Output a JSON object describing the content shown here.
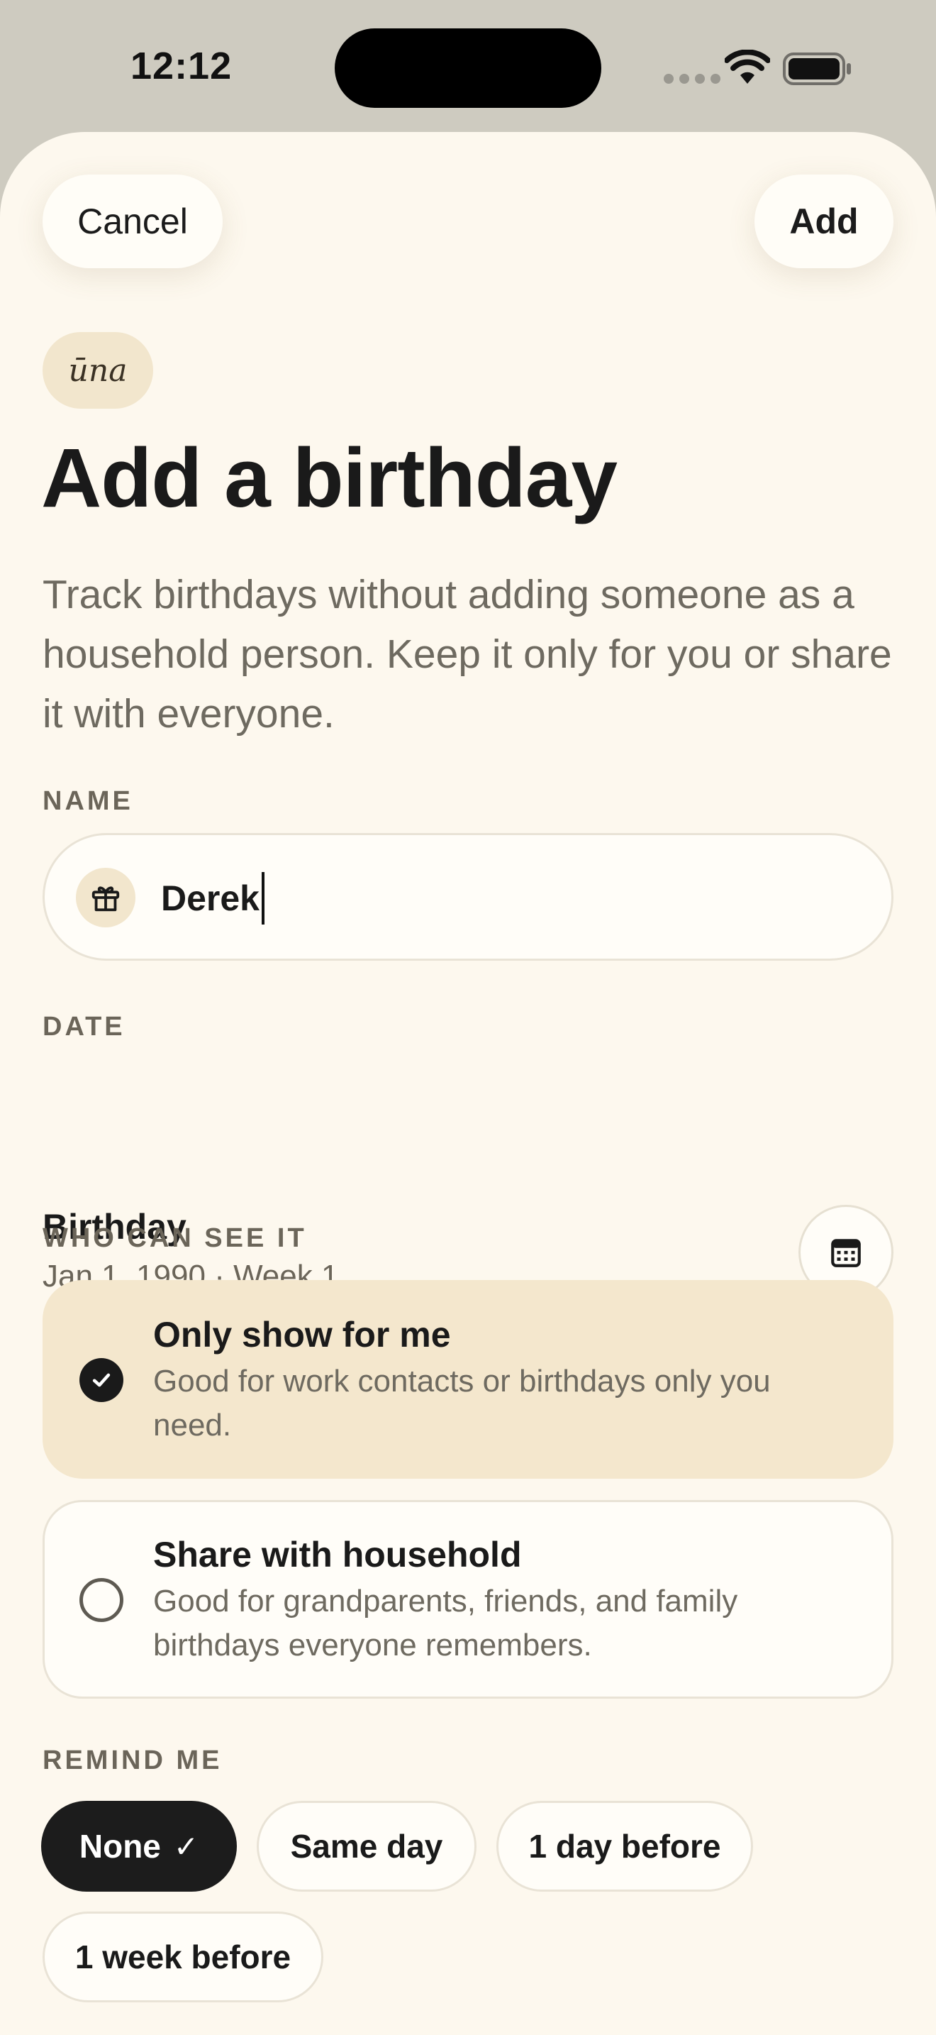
{
  "status_bar": {
    "time": "12:12"
  },
  "header": {
    "cancel_label": "Cancel",
    "add_label": "Add"
  },
  "brand": "ūna",
  "title": "Add a birthday",
  "subtitle": "Track birthdays without adding someone as a household person. Keep it only for you or share it with everyone.",
  "name_section": {
    "label": "NAME",
    "value": "Derek",
    "icon": "gift-icon"
  },
  "date_section": {
    "label": "DATE",
    "title": "Birthday",
    "value": "Jan 1, 1990 · Week 1",
    "icon": "calendar-icon"
  },
  "visibility": {
    "label": "WHO CAN SEE IT",
    "options": [
      {
        "title": "Only show for me",
        "description": "Good for work contacts or birthdays only you need.",
        "selected": true
      },
      {
        "title": "Share with household",
        "description": "Good for grandparents, friends, and family birthdays everyone remembers.",
        "selected": false
      }
    ]
  },
  "reminder": {
    "label": "REMIND ME",
    "options": [
      {
        "label": "None",
        "selected": true
      },
      {
        "label": "Same day",
        "selected": false
      },
      {
        "label": "1 day before",
        "selected": false
      },
      {
        "label": "1 week before",
        "selected": false
      }
    ]
  },
  "colors": {
    "background": "#FDF8EE",
    "accent": "#F4E7CD",
    "dark": "#1C1C1C"
  }
}
